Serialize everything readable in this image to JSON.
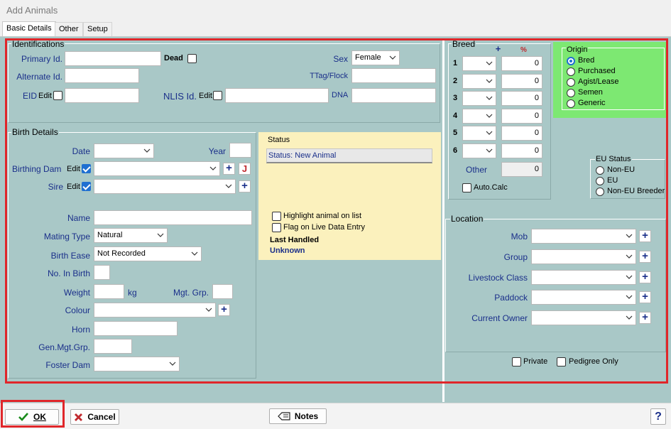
{
  "window": {
    "title": "Add Animals"
  },
  "tabs": [
    {
      "label": "Basic Details"
    },
    {
      "label": "Other"
    },
    {
      "label": "Setup"
    }
  ],
  "identifications": {
    "title": "Identifications",
    "primary_id_label": "Primary Id.",
    "dead_label": "Dead",
    "sex_label": "Sex",
    "sex_value": "Female",
    "alternate_id_label": "Alternate Id.",
    "ttag_label": "TTag/Flock",
    "eid_label": "EID",
    "edit_label": "Edit",
    "nlis_label": "NLIS Id.",
    "dna_label": "DNA"
  },
  "birth": {
    "title": "Birth Details",
    "date_label": "Date",
    "year_label": "Year",
    "dam_label": "Birthing Dam",
    "sire_label": "Sire",
    "edit_label": "Edit",
    "name_label": "Name",
    "mating_type_label": "Mating Type",
    "mating_type_value": "Natural",
    "birth_ease_label": "Birth Ease",
    "birth_ease_value": "Not Recorded",
    "no_in_birth_label": "No. In Birth",
    "weight_label": "Weight",
    "kg_label": "kg",
    "mgt_grp_label": "Mgt. Grp.",
    "colour_label": "Colour",
    "horn_label": "Horn",
    "gen_mgt_label": "Gen.Mgt.Grp.",
    "foster_dam_label": "Foster Dam"
  },
  "status": {
    "title": "Status",
    "value": "Status: New Animal",
    "highlight_label": "Highlight animal on list",
    "flag_label": "Flag on Live Data Entry",
    "last_handled_label": "Last Handled",
    "last_handled_value": "Unknown"
  },
  "breed": {
    "title": "Breed",
    "plus": "+",
    "pct_label": "%",
    "rows": [
      {
        "num": "1",
        "pct": "0"
      },
      {
        "num": "2",
        "pct": "0"
      },
      {
        "num": "3",
        "pct": "0"
      },
      {
        "num": "4",
        "pct": "0"
      },
      {
        "num": "5",
        "pct": "0"
      },
      {
        "num": "6",
        "pct": "0"
      }
    ],
    "other_label": "Other",
    "other_value": "0",
    "autocalc_label": "Auto.Calc"
  },
  "origin": {
    "title": "Origin",
    "options": [
      "Bred",
      "Purchased",
      "Agist/Lease",
      "Semen",
      "Generic"
    ],
    "selected": "Bred"
  },
  "eu_status": {
    "title": "EU Status",
    "options": [
      "Non-EU",
      "EU",
      "Non-EU Breeder"
    ]
  },
  "location": {
    "title": "Location",
    "mob_label": "Mob",
    "group_label": "Group",
    "livestock_class_label": "Livestock Class",
    "paddock_label": "Paddock",
    "current_owner_label": "Current Owner",
    "private_label": "Private",
    "pedigree_only_label": "Pedigree Only"
  },
  "footer": {
    "ok_label": "OK",
    "cancel_label": "Cancel",
    "notes_label": "Notes",
    "help_label": "?"
  },
  "colors": {
    "panel_bg": "#a9c8c7",
    "status_bg": "#fbf1bd",
    "origin_bg": "#7de872",
    "highlight_red": "#e0262a",
    "label_blue": "#1a2f8a"
  }
}
